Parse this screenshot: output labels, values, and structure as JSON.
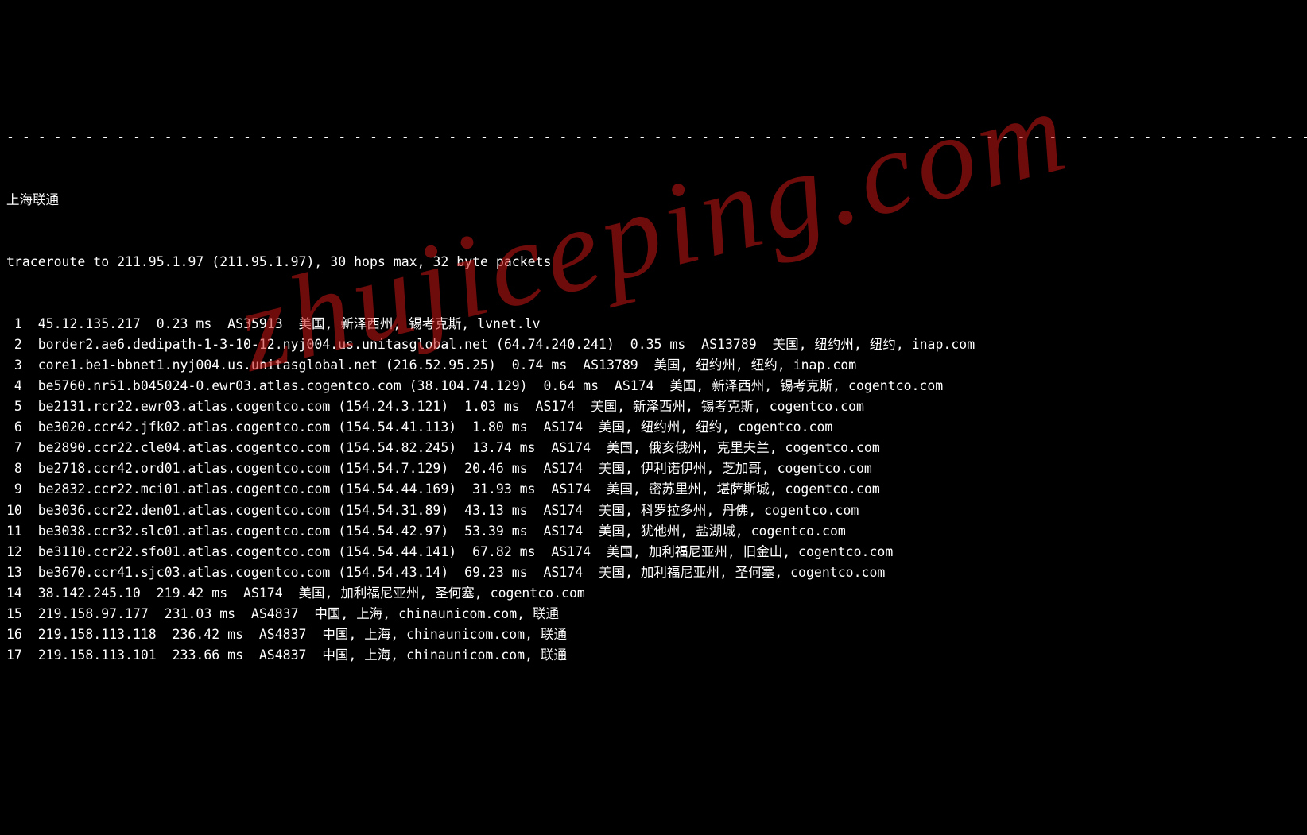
{
  "separator": "- - - - - - - - - - - - - - - - - - - - - - - - - - - - - - - - - - - - - - - - - - - - - - - - - - - - - - - - - - - - - - - - - - - - - - - - - - - - - - - - - - - - - - - - -",
  "title": "上海联通",
  "header": "traceroute to 211.95.1.97 (211.95.1.97), 30 hops max, 32 byte packets",
  "hops": [
    {
      "hop": "1",
      "host": "45.12.135.217",
      "ip": "",
      "ms": "0.23 ms",
      "asn": "AS35913",
      "loc": "美国, 新泽西州, 锡考克斯, lvnet.lv"
    },
    {
      "hop": "2",
      "host": "border2.ae6.dedipath-1-3-10-12.nyj004.us.unitasglobal.net",
      "ip": "(64.74.240.241)",
      "ms": "0.35 ms",
      "asn": "AS13789",
      "loc": "美国, 纽约州, 纽约, inap.com"
    },
    {
      "hop": "3",
      "host": "core1.be1-bbnet1.nyj004.us.unitasglobal.net",
      "ip": "(216.52.95.25)",
      "ms": "0.74 ms",
      "asn": "AS13789",
      "loc": "美国, 纽约州, 纽约, inap.com"
    },
    {
      "hop": "4",
      "host": "be5760.nr51.b045024-0.ewr03.atlas.cogentco.com",
      "ip": "(38.104.74.129)",
      "ms": "0.64 ms",
      "asn": "AS174",
      "loc": "美国, 新泽西州, 锡考克斯, cogentco.com"
    },
    {
      "hop": "5",
      "host": "be2131.rcr22.ewr03.atlas.cogentco.com",
      "ip": "(154.24.3.121)",
      "ms": "1.03 ms",
      "asn": "AS174",
      "loc": "美国, 新泽西州, 锡考克斯, cogentco.com"
    },
    {
      "hop": "6",
      "host": "be3020.ccr42.jfk02.atlas.cogentco.com",
      "ip": "(154.54.41.113)",
      "ms": "1.80 ms",
      "asn": "AS174",
      "loc": "美国, 纽约州, 纽约, cogentco.com"
    },
    {
      "hop": "7",
      "host": "be2890.ccr22.cle04.atlas.cogentco.com",
      "ip": "(154.54.82.245)",
      "ms": "13.74 ms",
      "asn": "AS174",
      "loc": "美国, 俄亥俄州, 克里夫兰, cogentco.com"
    },
    {
      "hop": "8",
      "host": "be2718.ccr42.ord01.atlas.cogentco.com",
      "ip": "(154.54.7.129)",
      "ms": "20.46 ms",
      "asn": "AS174",
      "loc": "美国, 伊利诺伊州, 芝加哥, cogentco.com"
    },
    {
      "hop": "9",
      "host": "be2832.ccr22.mci01.atlas.cogentco.com",
      "ip": "(154.54.44.169)",
      "ms": "31.93 ms",
      "asn": "AS174",
      "loc": "美国, 密苏里州, 堪萨斯城, cogentco.com"
    },
    {
      "hop": "10",
      "host": "be3036.ccr22.den01.atlas.cogentco.com",
      "ip": "(154.54.31.89)",
      "ms": "43.13 ms",
      "asn": "AS174",
      "loc": "美国, 科罗拉多州, 丹佛, cogentco.com"
    },
    {
      "hop": "11",
      "host": "be3038.ccr32.slc01.atlas.cogentco.com",
      "ip": "(154.54.42.97)",
      "ms": "53.39 ms",
      "asn": "AS174",
      "loc": "美国, 犹他州, 盐湖城, cogentco.com"
    },
    {
      "hop": "12",
      "host": "be3110.ccr22.sfo01.atlas.cogentco.com",
      "ip": "(154.54.44.141)",
      "ms": "67.82 ms",
      "asn": "AS174",
      "loc": "美国, 加利福尼亚州, 旧金山, cogentco.com"
    },
    {
      "hop": "13",
      "host": "be3670.ccr41.sjc03.atlas.cogentco.com",
      "ip": "(154.54.43.14)",
      "ms": "69.23 ms",
      "asn": "AS174",
      "loc": "美国, 加利福尼亚州, 圣何塞, cogentco.com"
    },
    {
      "hop": "14",
      "host": "38.142.245.10",
      "ip": "",
      "ms": "219.42 ms",
      "asn": "AS174",
      "loc": "美国, 加利福尼亚州, 圣何塞, cogentco.com"
    },
    {
      "hop": "15",
      "host": "219.158.97.177",
      "ip": "",
      "ms": "231.03 ms",
      "asn": "AS4837",
      "loc": "中国, 上海, chinaunicom.com, 联通"
    },
    {
      "hop": "16",
      "host": "219.158.113.118",
      "ip": "",
      "ms": "236.42 ms",
      "asn": "AS4837",
      "loc": "中国, 上海, chinaunicom.com, 联通"
    },
    {
      "hop": "17",
      "host": "219.158.113.101",
      "ip": "",
      "ms": "233.66 ms",
      "asn": "AS4837",
      "loc": "中国, 上海, chinaunicom.com, 联通"
    }
  ],
  "watermark": "zhujiceping.com"
}
